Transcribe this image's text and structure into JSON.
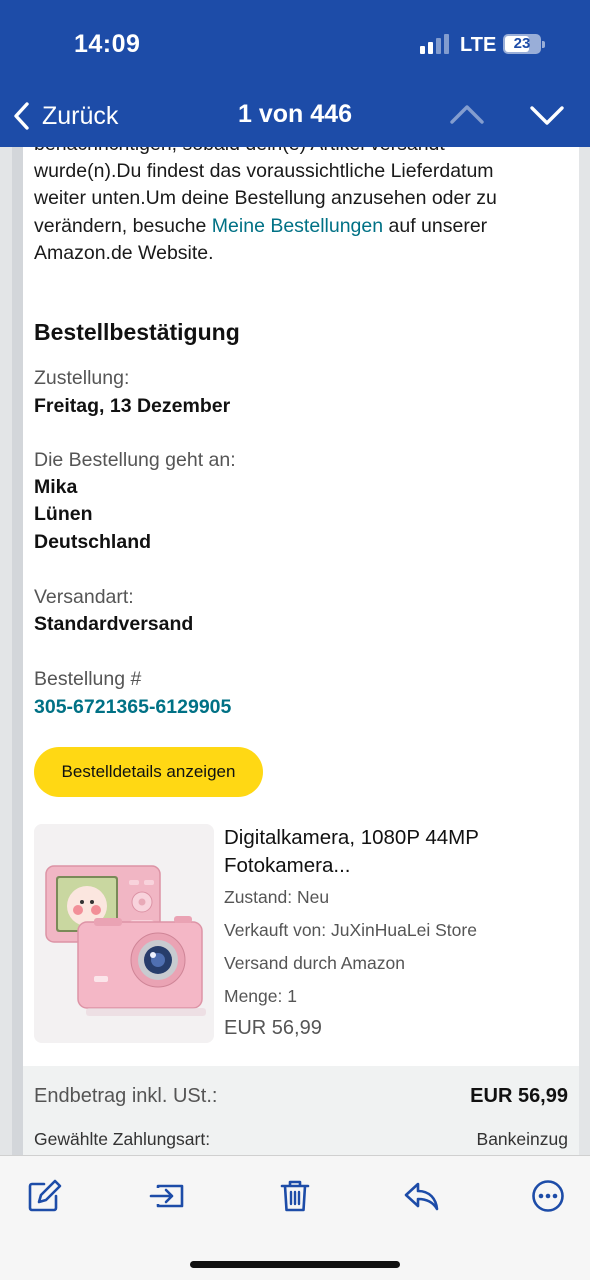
{
  "status_bar": {
    "time": "14:09",
    "network": "LTE",
    "battery": "23",
    "signal_bars_active": 2,
    "signal_bars_total": 4
  },
  "nav": {
    "back_label": "Zurück",
    "counter": "1 von 446"
  },
  "intro": {
    "line1": "benachrichtigen, sobald dein(e) Artikel versandt",
    "line2": "wurde(n).Du findest das voraussichtliche Lieferdatum",
    "line3": "weiter unten.Um deine Bestellung anzusehen oder zu",
    "line4_prefix": "verändern, besuche ",
    "line4_link": "Meine Bestellungen",
    "line4_suffix": " auf unserer",
    "line5": "Amazon.de Website."
  },
  "order": {
    "title": "Bestellbestätigung",
    "delivery_label": "Zustellung:",
    "delivery_value": "Freitag, 13 Dezember",
    "recipient_label": "Die Bestellung geht an:",
    "recipient_name": "Mika",
    "recipient_city": "Lünen",
    "recipient_country": "Deutschland",
    "shipping_label": "Versandart:",
    "shipping_value": "Standardversand",
    "order_number_label": "Bestellung #",
    "order_number": "305-6721365-6129905",
    "details_button": "Bestelldetails anzeigen"
  },
  "product": {
    "name_line1": "Digitalkamera, 1080P 44MP",
    "name_line2": "Fotokamera...",
    "condition": "Zustand: Neu",
    "seller": "Verkauft von: JuXinHuaLei Store",
    "fulfilled": "Versand durch Amazon",
    "quantity": "Menge: 1",
    "price": "EUR 56,99"
  },
  "totals": {
    "total_label": "Endbetrag inkl. USt.:",
    "total_value": "EUR 56,99",
    "payment_label": "Gewählte Zahlungsart:",
    "payment_value": "Bankeinzug"
  },
  "toolbar": {
    "icons": [
      "compose-icon",
      "move-to-folder-icon",
      "trash-icon",
      "reply-icon",
      "more-icon"
    ]
  },
  "colors": {
    "header": "#1d4ca8",
    "link": "#007185",
    "button": "#ffd814",
    "toolbar_icon": "#1d4ca8"
  }
}
